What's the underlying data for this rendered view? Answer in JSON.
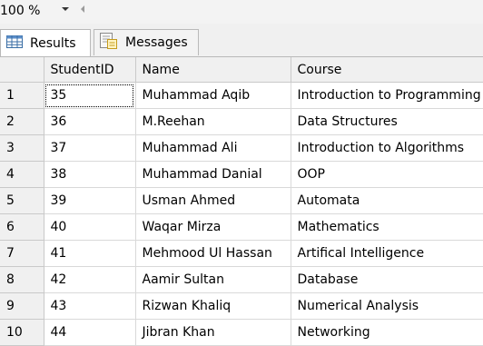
{
  "toolbar": {
    "zoom": "100 %"
  },
  "tabs": [
    {
      "label": "Results",
      "active": true,
      "icon": "grid-icon"
    },
    {
      "label": "Messages",
      "active": false,
      "icon": "messages-icon"
    }
  ],
  "grid": {
    "columns": [
      "",
      "StudentID",
      "Name",
      "Course"
    ],
    "rows": [
      {
        "num": "1",
        "id": "35",
        "name": "Muhammad Aqib",
        "course": "Introduction to Programming"
      },
      {
        "num": "2",
        "id": "36",
        "name": "M.Reehan",
        "course": "Data Structures"
      },
      {
        "num": "3",
        "id": "37",
        "name": "Muhammad Ali",
        "course": "Introduction to Algorithms"
      },
      {
        "num": "4",
        "id": "38",
        "name": "Muhammad Danial",
        "course": "OOP"
      },
      {
        "num": "5",
        "id": "39",
        "name": "Usman Ahmed",
        "course": "Automata"
      },
      {
        "num": "6",
        "id": "40",
        "name": "Waqar Mirza",
        "course": "Mathematics"
      },
      {
        "num": "7",
        "id": "41",
        "name": "Mehmood Ul Hassan",
        "course": "Artifical Intelligence"
      },
      {
        "num": "8",
        "id": "42",
        "name": "Aamir Sultan",
        "course": "Database"
      },
      {
        "num": "9",
        "id": "43",
        "name": "Rizwan Khaliq",
        "course": "Numerical Analysis"
      },
      {
        "num": "10",
        "id": "44",
        "name": "Jibran Khan",
        "course": "Networking"
      }
    ]
  },
  "colors": {
    "header_bg": "#f0f0f0",
    "grid_line": "#d9d9d9"
  }
}
